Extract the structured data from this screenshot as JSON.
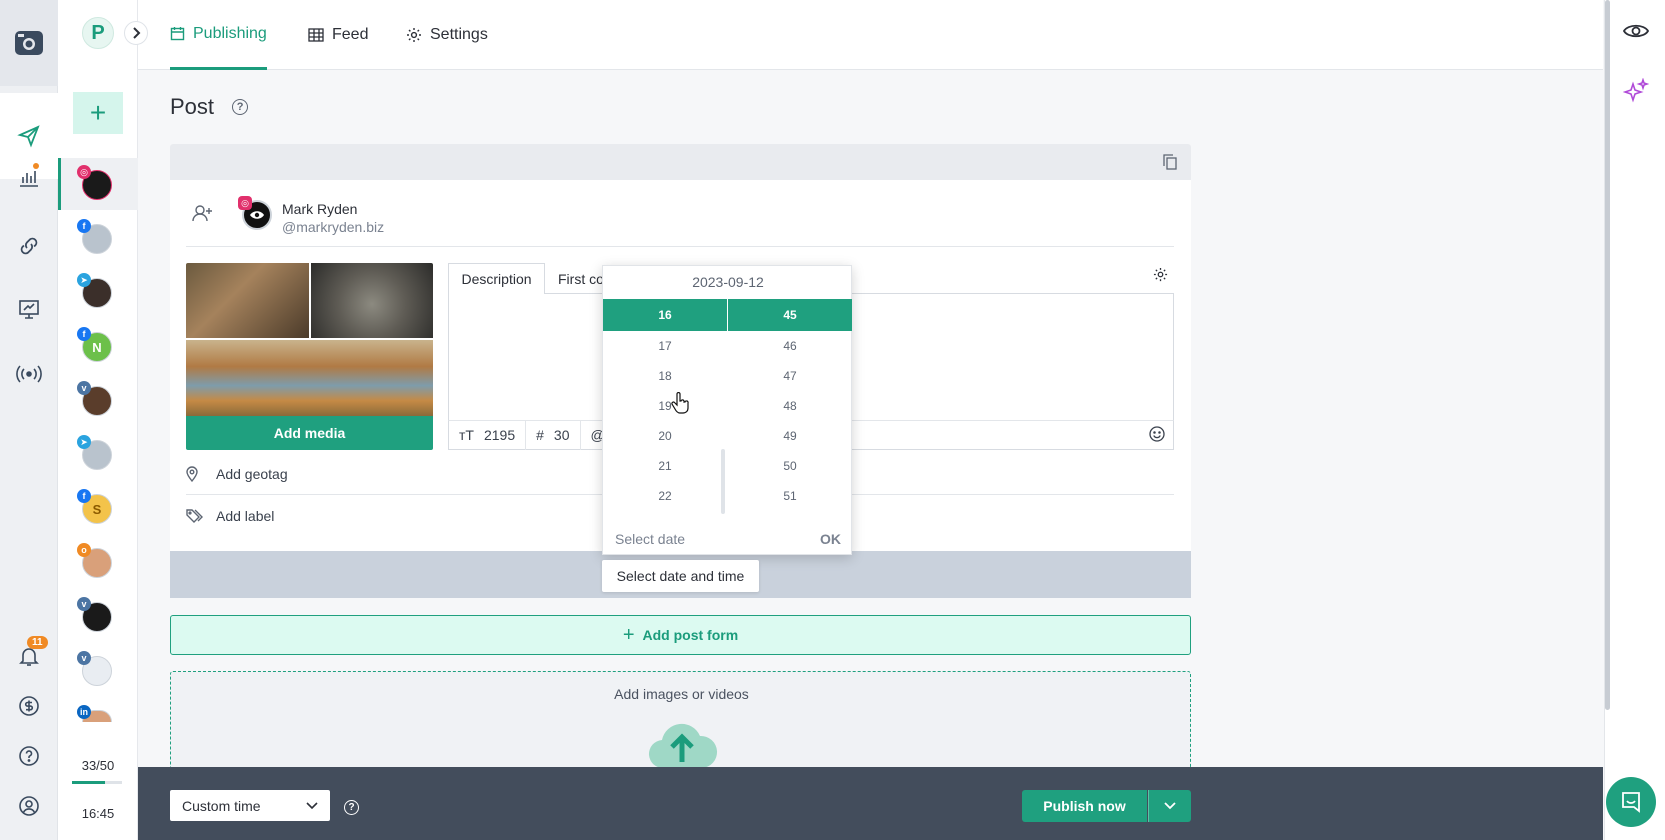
{
  "nav": {
    "tabs": [
      {
        "label": "Publishing",
        "icon": "calendar-icon",
        "active": true
      },
      {
        "label": "Feed",
        "icon": "grid-icon"
      },
      {
        "label": "Settings",
        "icon": "gear-icon"
      }
    ]
  },
  "accounts": {
    "workspace_initial": "P",
    "notifications_count": "11",
    "usage": "33/50",
    "usage_fraction": 0.66,
    "clock": "16:45",
    "items": [
      {
        "network": "instagram",
        "letter": ""
      },
      {
        "network": "facebook",
        "letter": ""
      },
      {
        "network": "telegram",
        "letter": ""
      },
      {
        "network": "facebook",
        "letter": "N"
      },
      {
        "network": "vk",
        "letter": ""
      },
      {
        "network": "telegram",
        "letter": ""
      },
      {
        "network": "facebook",
        "letter": "S"
      },
      {
        "network": "odnoklassniki",
        "letter": ""
      },
      {
        "network": "vk",
        "letter": ""
      },
      {
        "network": "vk",
        "letter": ""
      },
      {
        "network": "linkedin",
        "letter": ""
      }
    ]
  },
  "post": {
    "title": "Post",
    "account_name": "Mark Ryden",
    "account_handle": "@markryden.biz",
    "add_media": "Add media",
    "tab_description": "Description",
    "tab_first_comment": "First co",
    "char_count": "2195",
    "hashtag_count": "30",
    "add_geotag": "Add geotag",
    "add_label": "Add label"
  },
  "picker": {
    "date": "2023-09-12",
    "hours": [
      "16",
      "17",
      "18",
      "19",
      "20",
      "21",
      "22"
    ],
    "minutes": [
      "45",
      "46",
      "47",
      "48",
      "49",
      "50",
      "51"
    ],
    "selected_hour": "16",
    "selected_minute": "45",
    "select_date": "Select date",
    "ok": "OK",
    "trigger_label": "Select date and time"
  },
  "actions": {
    "add_post_form": "Add post form",
    "add_images": "Add images or videos",
    "custom_time": "Custom time",
    "publish_now": "Publish now"
  },
  "colors": {
    "accent": "#1fa07f",
    "instagram": "#e1306c",
    "facebook": "#1877f2",
    "telegram": "#2aa3df",
    "vk": "#4c75a3",
    "odnoklassniki": "#f08a24",
    "linkedin": "#0a66c2"
  }
}
